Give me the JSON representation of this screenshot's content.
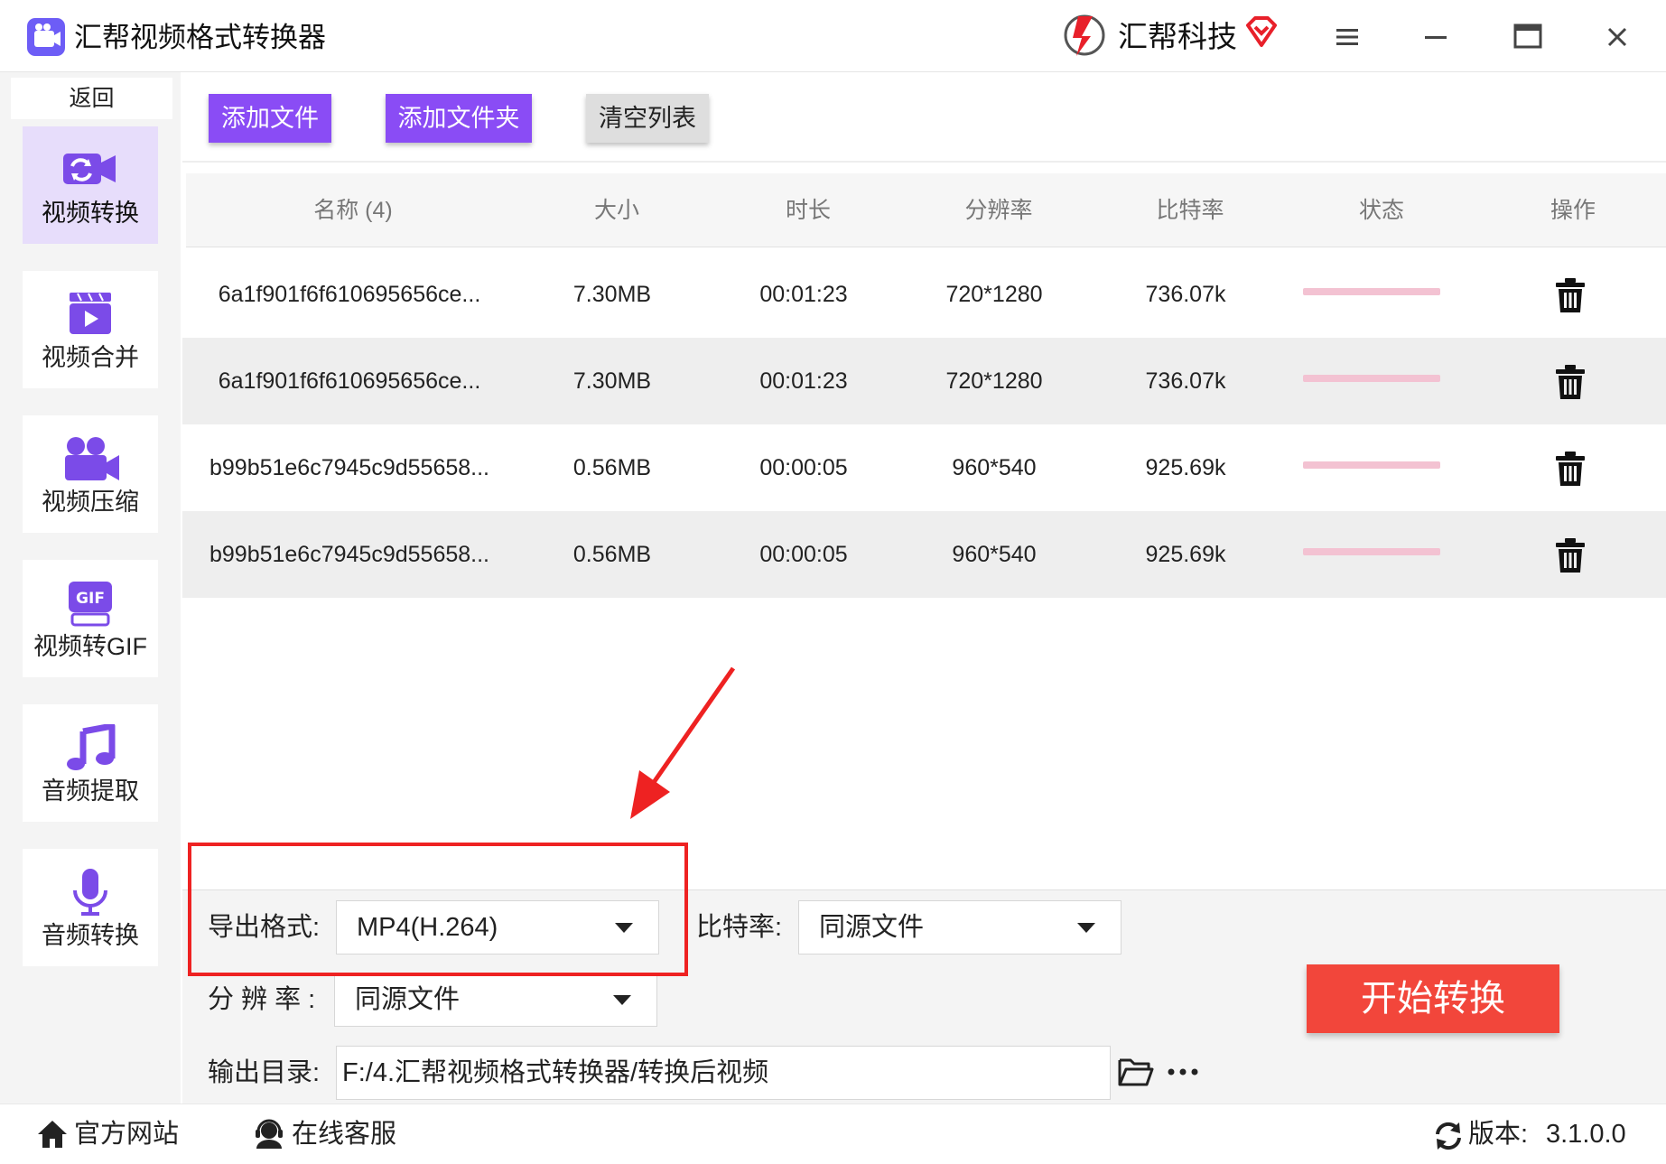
{
  "app": {
    "title": "汇帮视频格式转换器",
    "brand_name": "汇帮科技"
  },
  "sidebar": {
    "back_label": "返回",
    "items": [
      {
        "label": "视频转换",
        "icon": "video-convert-icon",
        "active": true
      },
      {
        "label": "视频合并",
        "icon": "video-merge-icon",
        "active": false
      },
      {
        "label": "视频压缩",
        "icon": "video-compress-icon",
        "active": false
      },
      {
        "label": "视频转GIF",
        "icon": "gif-icon",
        "active": false
      },
      {
        "label": "音频提取",
        "icon": "music-note-icon",
        "active": false
      },
      {
        "label": "音频转换",
        "icon": "microphone-icon",
        "active": false
      }
    ]
  },
  "toolbar": {
    "add_file": "添加文件",
    "add_folder": "添加文件夹",
    "clear_list": "清空列表"
  },
  "table": {
    "columns": [
      "名称 (4)",
      "大小",
      "时长",
      "分辨率",
      "比特率",
      "状态",
      "操作"
    ],
    "rows": [
      {
        "name": "6a1f901f6f610695656ce...",
        "size": "7.30MB",
        "duration": "00:01:23",
        "resolution": "720*1280",
        "bitrate": "736.07k"
      },
      {
        "name": "6a1f901f6f610695656ce...",
        "size": "7.30MB",
        "duration": "00:01:23",
        "resolution": "720*1280",
        "bitrate": "736.07k"
      },
      {
        "name": "b99b51e6c7945c9d55658...",
        "size": "0.56MB",
        "duration": "00:00:05",
        "resolution": "960*540",
        "bitrate": "925.69k"
      },
      {
        "name": "b99b51e6c7945c9d55658...",
        "size": "0.56MB",
        "duration": "00:00:05",
        "resolution": "960*540",
        "bitrate": "925.69k"
      }
    ]
  },
  "settings": {
    "format_label": "导出格式:",
    "format_value": "MP4(H.264)",
    "bitrate_label": "比特率:",
    "bitrate_value": "同源文件",
    "resolution_label": "分 辨 率 :",
    "resolution_value": "同源文件",
    "output_label": "输出目录:",
    "output_value": "F:/4.汇帮视频格式转换器/转换后视频"
  },
  "start_button": "开始转换",
  "footer": {
    "website": "官方网站",
    "support": "在线客服",
    "version_label": "版本:",
    "version_value": "3.1.0.0"
  },
  "colors": {
    "accent_purple": "#8a4cf5",
    "start_red": "#f2463b",
    "annotation_red": "#ee2222",
    "progress_pink": "#f3c2d2",
    "active_nav_bg": "#e7ddfb"
  }
}
